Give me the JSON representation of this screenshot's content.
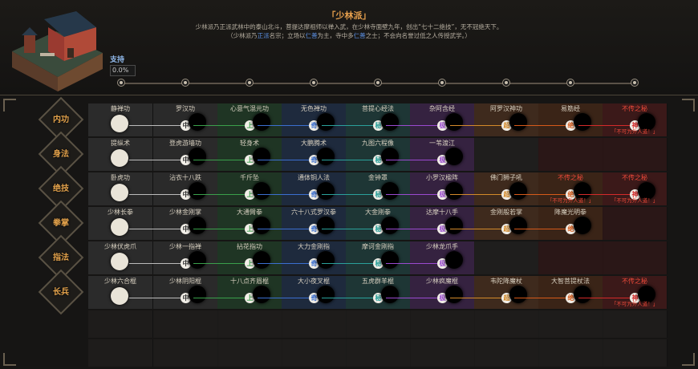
{
  "header": {
    "title": "「少林派」",
    "desc_line1_a": "少林派乃正派武林中的泰山北斗，菩提达摩祖师以禅入武，在少林寺面壁九年，创出",
    "desc_line1_b": "“七十二绝技”",
    "desc_line1_c": "，无不冠绝天下。",
    "desc_line2_a": "（少林派乃",
    "desc_line2_b": "正派",
    "desc_line2_c": "名宗；立场以",
    "desc_line2_d": "仁善",
    "desc_line2_e": "为主，寺中多",
    "desc_line2_f": "仁善",
    "desc_line2_g": "之士；不会向名誉过低之人传授武学。）",
    "support_label": "支持",
    "support_value": "0.0%"
  },
  "colors": {
    "accent": "#e3a24b",
    "tier_bg": [
      "#2b2b2b",
      "#2a2a2a",
      "#1f3524",
      "#1e2a3d",
      "#1e3635",
      "#352240",
      "#3e2a1d",
      "#3a2417",
      "#3b1919"
    ],
    "tier_badge_text": [
      "#333333",
      "#333333",
      "#3aa04b",
      "#3b6fd0",
      "#2aa19b",
      "#9a4ad0",
      "#d48a2a",
      "#d65a1a",
      "#d42a2a"
    ]
  },
  "badges": [
    "中",
    "中",
    "中",
    "中",
    "中",
    "中",
    "中",
    "中",
    "中"
  ],
  "rows": [
    {
      "label": "内功",
      "icon": "meditation-icon",
      "cells": [
        {
          "name": "静禅功",
          "badge": "下"
        },
        {
          "name": "罗汉功",
          "badge": "中"
        },
        {
          "name": "心意气混元功",
          "badge": "上"
        },
        {
          "name": "无色禅功",
          "badge": "奇"
        },
        {
          "name": "菩提心经法",
          "badge": "秘"
        },
        {
          "name": "杂阿含经",
          "badge": "极"
        },
        {
          "name": "阿罗汉神功",
          "badge": "超"
        },
        {
          "name": "易筋经",
          "badge": "绝"
        },
        {
          "name": "不传之秘",
          "badge": "神",
          "sub": "「不可为外人道！」",
          "red": true
        }
      ]
    },
    {
      "label": "身法",
      "icon": "running-icon",
      "cells": [
        {
          "name": "提纵术",
          "badge": "下"
        },
        {
          "name": "登虎游墙功",
          "badge": "中"
        },
        {
          "name": "轻身术",
          "badge": "上"
        },
        {
          "name": "大鹏腾术",
          "badge": "奇"
        },
        {
          "name": "九图六程像",
          "badge": "秘"
        },
        {
          "name": "一苇渡江",
          "badge": "极"
        }
      ]
    },
    {
      "label": "绝技",
      "icon": "crossed-swords-icon",
      "cells": [
        {
          "name": "卧虎功",
          "badge": "下"
        },
        {
          "name": "沾衣十八跌",
          "badge": "中"
        },
        {
          "name": "千斤坠",
          "badge": "上"
        },
        {
          "name": "通体铜人法",
          "badge": "奇"
        },
        {
          "name": "金钟罩",
          "badge": "秘"
        },
        {
          "name": "小罗汉楹阵",
          "badge": "极"
        },
        {
          "name": "佛门狮子吼",
          "badge": "超"
        },
        {
          "name": "不传之秘",
          "badge": "绝",
          "sub": "「不可为外人道！」",
          "red": true
        },
        {
          "name": "不传之秘",
          "badge": "神",
          "sub": "「不可为外人道！」",
          "red": true
        }
      ]
    },
    {
      "label": "拳掌",
      "icon": "fist-icon",
      "cells": [
        {
          "name": "少林长拳",
          "badge": "下"
        },
        {
          "name": "少林金刚掌",
          "badge": "中"
        },
        {
          "name": "大通臂拳",
          "badge": "上"
        },
        {
          "name": "六十八式罗汉拳",
          "badge": "奇"
        },
        {
          "name": "大金刚拳",
          "badge": "秘"
        },
        {
          "name": "达摩十八手",
          "badge": "极"
        },
        {
          "name": "金刚般若掌",
          "badge": "超"
        },
        {
          "name": "降魔光明拳",
          "badge": "绝"
        }
      ]
    },
    {
      "label": "指法",
      "icon": "finger-icon",
      "cells": [
        {
          "name": "少林伏虎爪",
          "badge": "下"
        },
        {
          "name": "少林一指禅",
          "badge": "中"
        },
        {
          "name": "拈花指功",
          "badge": "上"
        },
        {
          "name": "大力金刚指",
          "badge": "奇"
        },
        {
          "name": "摩诃金刚指",
          "badge": "秘"
        },
        {
          "name": "少林龙爪手",
          "badge": "极"
        }
      ]
    },
    {
      "label": "长兵",
      "icon": "staff-icon",
      "cells": [
        {
          "name": "少林六合棍",
          "badge": "下"
        },
        {
          "name": "少林阴阳棍",
          "badge": "中"
        },
        {
          "name": "十八点齐眉棍",
          "badge": "上"
        },
        {
          "name": "大小夜叉棍",
          "badge": "奇"
        },
        {
          "name": "五虎群羊棍",
          "badge": "秘"
        },
        {
          "name": "少林疯魔棍",
          "badge": "极"
        },
        {
          "name": "韦陀降魔杖",
          "badge": "超"
        },
        {
          "name": "大智菩提杖法",
          "badge": "绝"
        },
        {
          "name": "不传之秘",
          "badge": "神",
          "sub": "「不可为外人道！」",
          "red": true
        }
      ]
    }
  ]
}
